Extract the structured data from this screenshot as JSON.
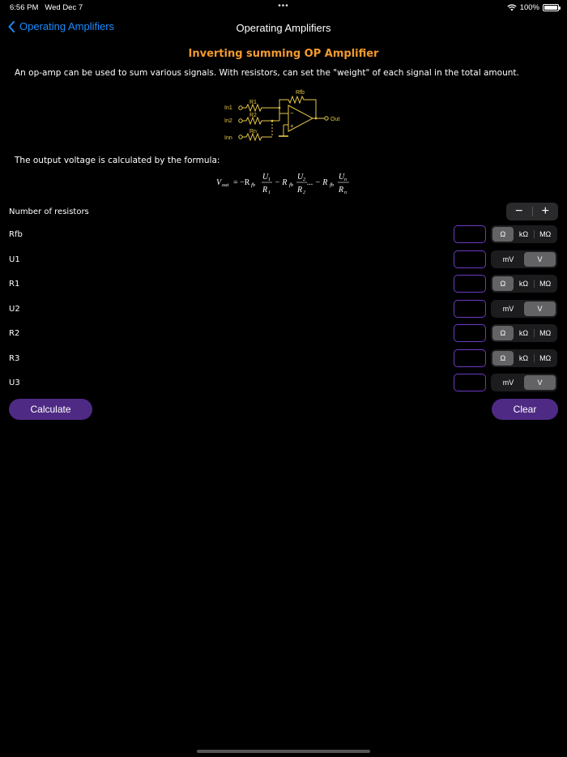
{
  "status": {
    "time": "6:56 PM",
    "date": "Wed Dec 7",
    "dots": "•••",
    "battery": "100%"
  },
  "nav": {
    "back_label": "Operating Amplifiers",
    "title": "Operating Amplifiers"
  },
  "content": {
    "section_title": "Inverting summing OP Amplifier",
    "description": "An op-amp can be used to sum various signals. With resistors, can set the \"weight\" of each signal in the total amount.",
    "formula_intro": "The output voltage is calculated by the formula:"
  },
  "circuit": {
    "labels": {
      "in1": "In1",
      "in2": "In2",
      "inn": "Inn",
      "r1": "R1",
      "r2": "R2",
      "rn": "Rn",
      "rfb": "Rfb",
      "out": "Out",
      "minus": "−",
      "plus": "+"
    }
  },
  "formula": {
    "vout": "V",
    "vout_sub": "out",
    "eq": "= −R",
    "fb": "fb",
    "u1": "U",
    "u1s": "1",
    "r1": "R",
    "r1s": "1",
    "minus1": "− R",
    "u2": "U",
    "u2s": "2",
    "r2": "R",
    "r2s": "2",
    "ellipsis": "... − R",
    "un": "U",
    "uns": "n",
    "rn": "R",
    "rns": "n"
  },
  "controls": {
    "number_label": "Number of resistors",
    "stepper_minus": "−",
    "stepper_plus": "+",
    "rows": [
      {
        "label": "Rfb",
        "value": "",
        "opts": [
          "Ω",
          "kΩ",
          "MΩ"
        ],
        "selected": 0
      },
      {
        "label": "U1",
        "value": "",
        "opts": [
          "mV",
          "V"
        ],
        "selected": 1
      },
      {
        "label": "R1",
        "value": "",
        "opts": [
          "Ω",
          "kΩ",
          "MΩ"
        ],
        "selected": 0
      },
      {
        "label": "U2",
        "value": "",
        "opts": [
          "mV",
          "V"
        ],
        "selected": 1
      },
      {
        "label": "R2",
        "value": "",
        "opts": [
          "Ω",
          "kΩ",
          "MΩ"
        ],
        "selected": 0
      },
      {
        "label": "R3",
        "value": "",
        "opts": [
          "Ω",
          "kΩ",
          "MΩ"
        ],
        "selected": 0
      },
      {
        "label": "U3",
        "value": "",
        "opts": [
          "mV",
          "V"
        ],
        "selected": 1
      }
    ],
    "calculate_label": "Calculate",
    "clear_label": "Clear"
  },
  "colors": {
    "accent": "#1a8cff",
    "title": "#f29a2e",
    "button": "#4e2a84",
    "field_border": "#6b3ac2",
    "circuit": "#e8c84a"
  }
}
